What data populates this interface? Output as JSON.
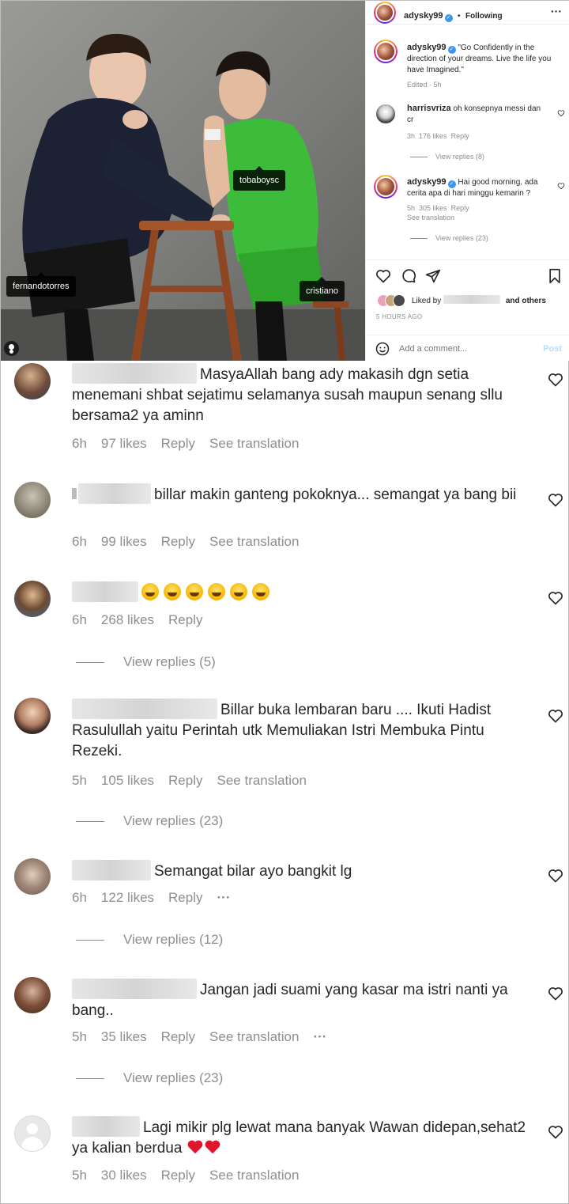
{
  "post": {
    "photo_tags": [
      "fernandotorres",
      "tobaboysc",
      "cristiano"
    ],
    "header": {
      "username": "adysky99",
      "separator": "•",
      "follow_status": "Following",
      "more": "···"
    },
    "caption": {
      "username": "adysky99",
      "text": "\"Go Confidently in the direction of your dreams. Live the life you have Imagined.\"",
      "meta": "Edited · 5h"
    },
    "comments": [
      {
        "username": "harrisvriza",
        "text": "oh konsepnya messi dan cr",
        "time": "3h",
        "likes": "176 likes",
        "reply": "Reply",
        "view_replies": "View replies (8)"
      },
      {
        "username": "adysky99",
        "text": "Hai good morning, ada cerita apa di hari minggu kemarin ?",
        "time": "5h",
        "likes": "305 likes",
        "reply": "Reply",
        "see_translation": "See translation",
        "view_replies": "View replies (23)"
      }
    ],
    "liked_by_prefix": "Liked by",
    "liked_by_suffix": "and others",
    "timestamp": "5 HOURS AGO",
    "add_comment_placeholder": "Add a comment...",
    "post_button": "Post"
  },
  "comments": [
    {
      "visible_text": "MasyaAllah bang ady makasih dgn setia menemani shbat sejatimu selamanya susah maupun senang sllu bersama2 ya aminn",
      "time": "6h",
      "likes": "97 likes",
      "reply": "Reply",
      "see_translation": "See translation"
    },
    {
      "visible_text": "billar makin ganteng pokoknya... semangat ya bang bii",
      "time": "6h",
      "likes": "99 likes",
      "reply": "Reply",
      "see_translation": "See translation"
    },
    {
      "visible_text": "",
      "emoji": [
        "rolling-on-floor-laughing",
        "rolling-on-floor-laughing",
        "rolling-on-floor-laughing",
        "rolling-on-floor-laughing",
        "rolling-on-floor-laughing",
        "rolling-on-floor-laughing"
      ],
      "time": "6h",
      "likes": "268 likes",
      "reply": "Reply",
      "view_replies": "View replies (5)"
    },
    {
      "visible_text": "Billar buka lembaran baru .... Ikuti Hadist Rasulullah yaitu Perintah utk Memuliakan Istri Membuka Pintu Rezeki.",
      "time": "5h",
      "likes": "105 likes",
      "reply": "Reply",
      "see_translation": "See translation",
      "view_replies": "View replies (23)"
    },
    {
      "visible_text": "Semangat bilar ayo bangkit lg",
      "time": "6h",
      "likes": "122 likes",
      "reply": "Reply",
      "more": "···",
      "view_replies": "View replies (12)"
    },
    {
      "visible_text": "Jangan jadi suami yang kasar ma istri nanti ya bang..",
      "time": "5h",
      "likes": "35 likes",
      "reply": "Reply",
      "see_translation": "See translation",
      "more": "···",
      "view_replies": "View replies (23)"
    },
    {
      "visible_text": "Lagi mikir plg lewat mana banyak Wawan didepan,sehat2 ya kalian berdua",
      "emoji": [
        "red-heart",
        "red-heart"
      ],
      "time": "5h",
      "likes": "30 likes",
      "reply": "Reply",
      "see_translation": "See translation"
    }
  ],
  "colors": {
    "verified": "#3897f0",
    "jersey_green": "#3dbb3a",
    "muted": "#8e8e8e",
    "post_button": "#b2dffc"
  }
}
